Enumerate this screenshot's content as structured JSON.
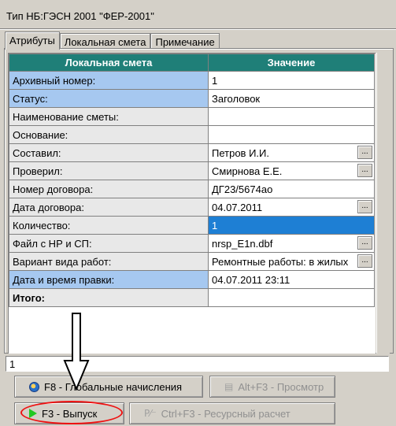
{
  "window": {
    "title": "Тип НБ:ГЭСН 2001 \"ФЕР-2001\""
  },
  "tabs": [
    {
      "label": "Атрибуты",
      "active": true
    },
    {
      "label": "Локальная смета",
      "active": false
    },
    {
      "label": "Примечание",
      "active": false
    }
  ],
  "grid": {
    "headers": {
      "name": "Локальная смета",
      "value": "Значение"
    },
    "rows": [
      {
        "name": "Архивный номер:",
        "value": "1"
      },
      {
        "name": "Статус:",
        "value": "Заголовок"
      },
      {
        "name": "Наименование сметы:",
        "value": ""
      },
      {
        "name": "Основание:",
        "value": ""
      },
      {
        "name": "Составил:",
        "value": "Петров И.И.",
        "ellipsis": "..."
      },
      {
        "name": "Проверил:",
        "value": "Смирнова Е.Е.",
        "ellipsis": "..."
      },
      {
        "name": "Номер договора:",
        "value": "ДГ23/5674ао"
      },
      {
        "name": "Дата договора:",
        "value": "04.07.2011",
        "ellipsis": "..."
      },
      {
        "name": "Количество:",
        "value": "1"
      },
      {
        "name": "Файл с НР и СП:",
        "value": "nrsp_E1n.dbf",
        "ellipsis": "..."
      },
      {
        "name": "Вариант вида работ:",
        "value": "Ремонтные работы: в жилых",
        "ellipsis": "..."
      },
      {
        "name": "Дата и время правки:",
        "value": "04.07.2011  23:11"
      },
      {
        "name": "Итого:",
        "value": ""
      }
    ]
  },
  "status_field": {
    "value": "1"
  },
  "buttons": {
    "global_charges": "F8 - Глобальные начисления",
    "preview": "Alt+F3 - Просмотр",
    "release": "F3 - Выпуск",
    "resource_calc": "Ctrl+F3 - Ресурсный расчет"
  },
  "icons": {
    "global_charges": "globe-icon",
    "preview": "document-preview-icon",
    "release": "play-icon",
    "resource_calc": "resource-chart-icon"
  },
  "colors": {
    "header_bg": "#1f7f78",
    "highlight_row": "#a6c8f0",
    "selected_cell": "#1e7fd4",
    "annotation": "#e11111"
  }
}
